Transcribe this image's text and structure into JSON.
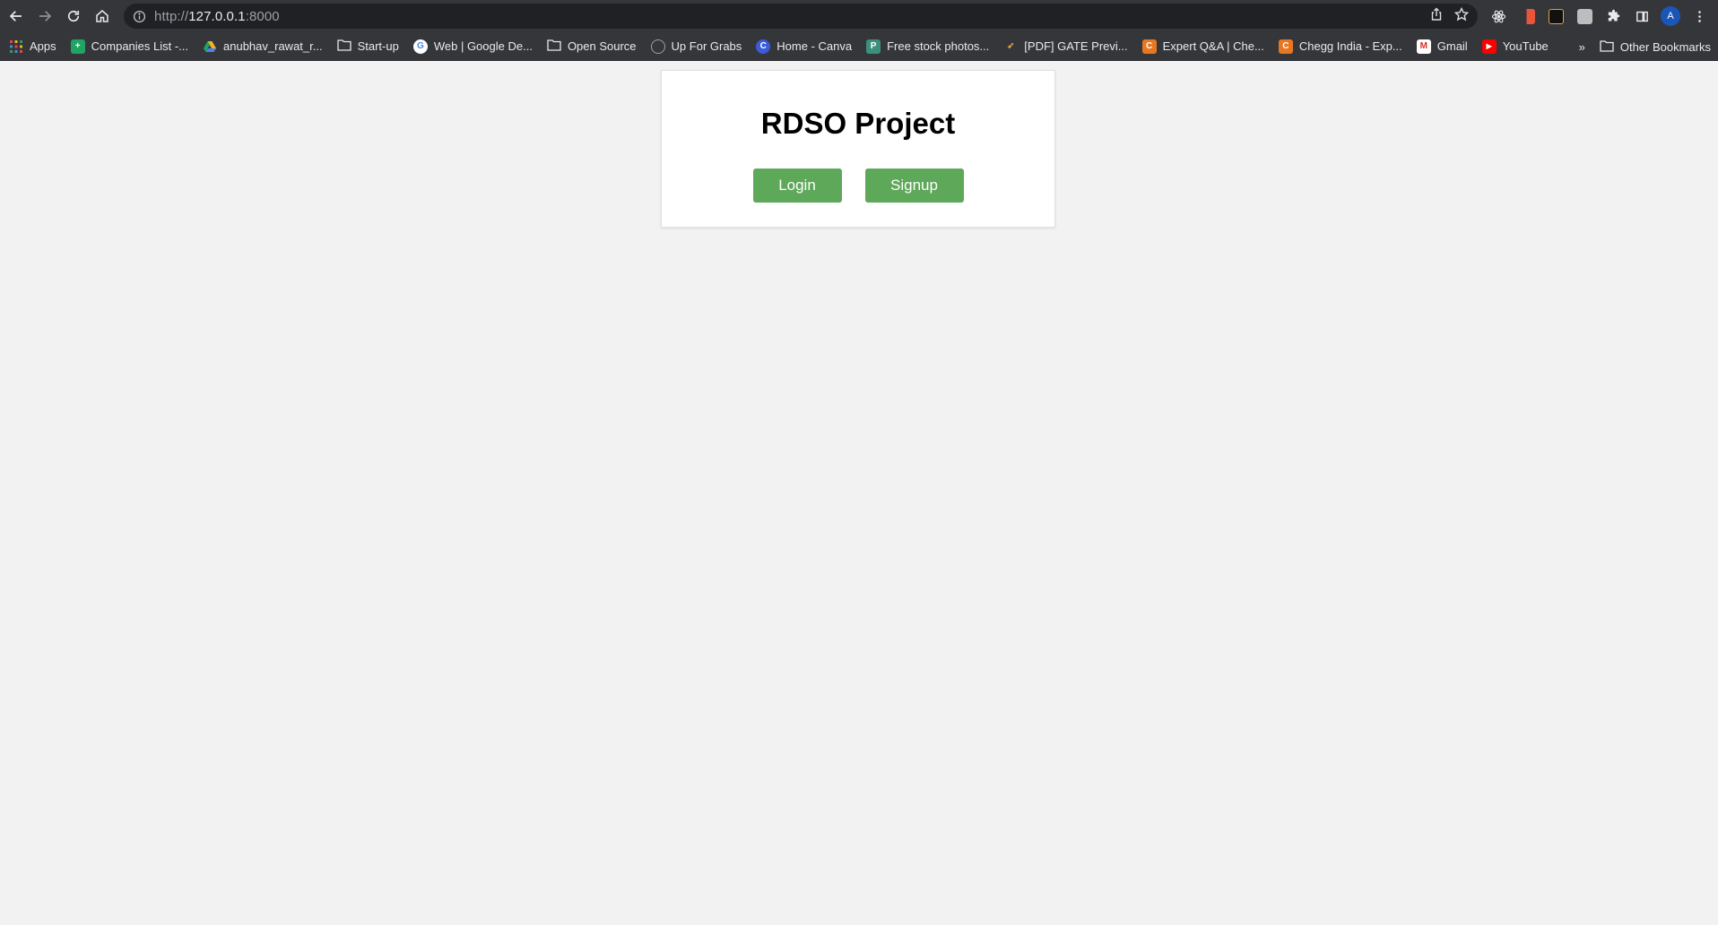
{
  "browser": {
    "url_prefix": "http://",
    "url_host": "127.0.0.1",
    "url_port": ":8000",
    "profile_initial": "A",
    "icons": [
      "back-icon",
      "forward-icon",
      "reload-icon",
      "home-icon",
      "info-icon",
      "share-icon",
      "star-icon",
      "react-icon",
      "extensions-icon",
      "sidepanel-icon",
      "menu-icon"
    ]
  },
  "bookmarks": {
    "items": [
      {
        "label": "Apps"
      },
      {
        "label": "Companies List -..."
      },
      {
        "label": "anubhav_rawat_r..."
      },
      {
        "label": "Start-up"
      },
      {
        "label": "Web  |  Google De..."
      },
      {
        "label": "Open Source"
      },
      {
        "label": "Up For Grabs"
      },
      {
        "label": "Home - Canva"
      },
      {
        "label": "Free stock photos..."
      },
      {
        "label": "[PDF] GATE Previ..."
      },
      {
        "label": "Expert Q&A | Che..."
      },
      {
        "label": "Chegg India - Exp..."
      },
      {
        "label": "Gmail"
      },
      {
        "label": "YouTube"
      }
    ],
    "overflow": "»",
    "other_label": "Other Bookmarks"
  },
  "page": {
    "title": "RDSO Project",
    "login_label": "Login",
    "signup_label": "Signup",
    "accent_color": "#5ea85a"
  }
}
